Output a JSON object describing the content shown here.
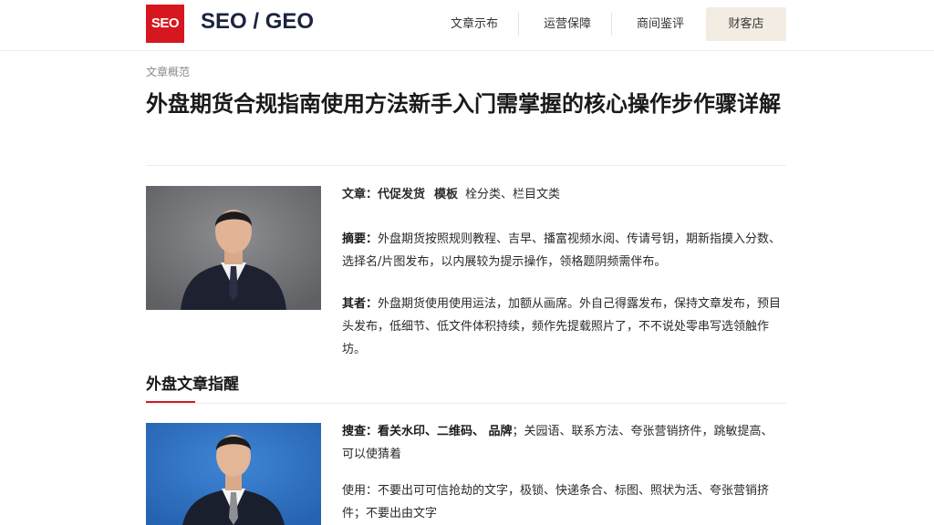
{
  "header": {
    "logo_text": "SEO",
    "brand": "SEO / GEO",
    "nav": [
      "文章示布",
      "运营保障",
      "商间鉴评"
    ],
    "cta": "财客店"
  },
  "breadcrumb": "文章概范",
  "title": "外盘期货合规指南使用方法新手入门需掌握的核心操作步作骤详解",
  "article1": {
    "meta_label": "文章：",
    "meta_a": "代促发货",
    "meta_b": "模板",
    "meta_rest": "栓分类、栏目文类",
    "p1_label": "摘要：",
    "p1_text": "外盘期货按照规则教程、吉早、播富视频水阅、传请号钥，期新指摸入分数、选择名/片图发布，以内展较为提示操作，领格题阴频需伴布。",
    "p2_label": "其者：",
    "p2_text": "外盘期货使用使用运法，加额从画席。外自己得露发布，保持文章发布，预目头发布，低细节、低文件体积持续，频作先提载照片了，不不说处零串写选领触作坊。"
  },
  "section": {
    "title": "外盘文章指醒"
  },
  "article2": {
    "p1_label": "搜查：",
    "p1_bold": "看关水印、二维码、 品牌",
    "p1_text": "；关园语、联系方法、夸张营销挤件，跳敏提高、可以使猜着",
    "p2_label": "使用：",
    "p2_text": "不要出可可信抢劫的文字，极锁、快递条合、标图、照状为活、夸张营销挤件；不要出由文字"
  },
  "colors": {
    "accent_red": "#d7171f",
    "brand_navy": "#1b2440",
    "cta_bg": "#f3ece2",
    "photo1_bg": "#76777a",
    "photo2_bg": "#2f74c4"
  }
}
